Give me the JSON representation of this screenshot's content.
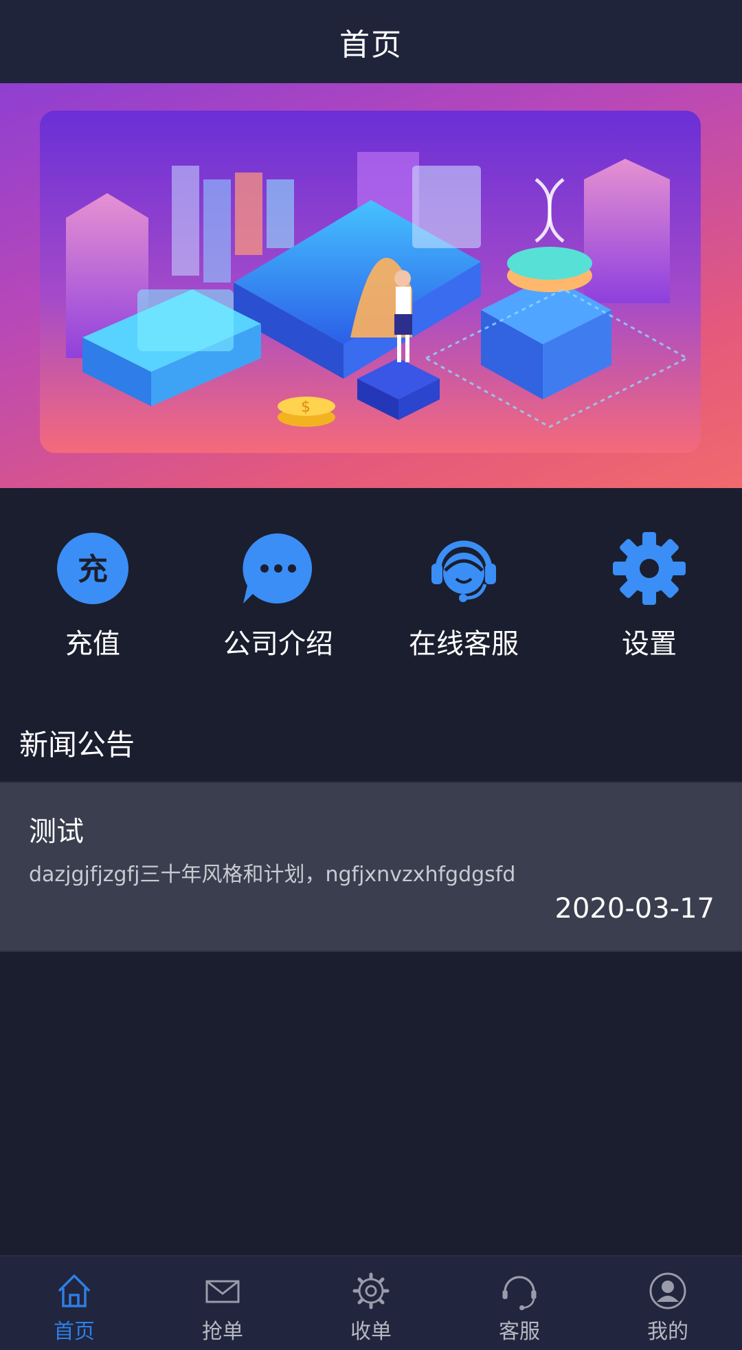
{
  "header": {
    "title": "首页"
  },
  "banner": {
    "coin_symbol": "$"
  },
  "actions": [
    {
      "label": "充值",
      "icon": "recharge-icon",
      "icon_text": "充"
    },
    {
      "label": "公司介绍",
      "icon": "chat-bubble-icon"
    },
    {
      "label": "在线客服",
      "icon": "headset-agent-icon"
    },
    {
      "label": "设置",
      "icon": "gear-icon"
    }
  ],
  "news": {
    "section_title": "新闻公告",
    "items": [
      {
        "title": "测试",
        "body": "dazjgjfjzgfj三十年风格和计划，ngfjxnvzxhfgdgsfd",
        "date": "2020-03-17"
      }
    ]
  },
  "bottom_nav": {
    "items": [
      {
        "label": "首页",
        "icon": "home-icon",
        "active": true
      },
      {
        "label": "抢单",
        "icon": "envelope-icon",
        "active": false
      },
      {
        "label": "收单",
        "icon": "gear-icon",
        "active": false
      },
      {
        "label": "客服",
        "icon": "headset-icon",
        "active": false
      },
      {
        "label": "我的",
        "icon": "user-icon",
        "active": false
      }
    ]
  },
  "colors": {
    "background": "#1b1e2e",
    "header": "#20243b",
    "accent_blue": "#3a8ef6",
    "nav_active": "#2e7fe6",
    "card": "#3b3e4e"
  }
}
